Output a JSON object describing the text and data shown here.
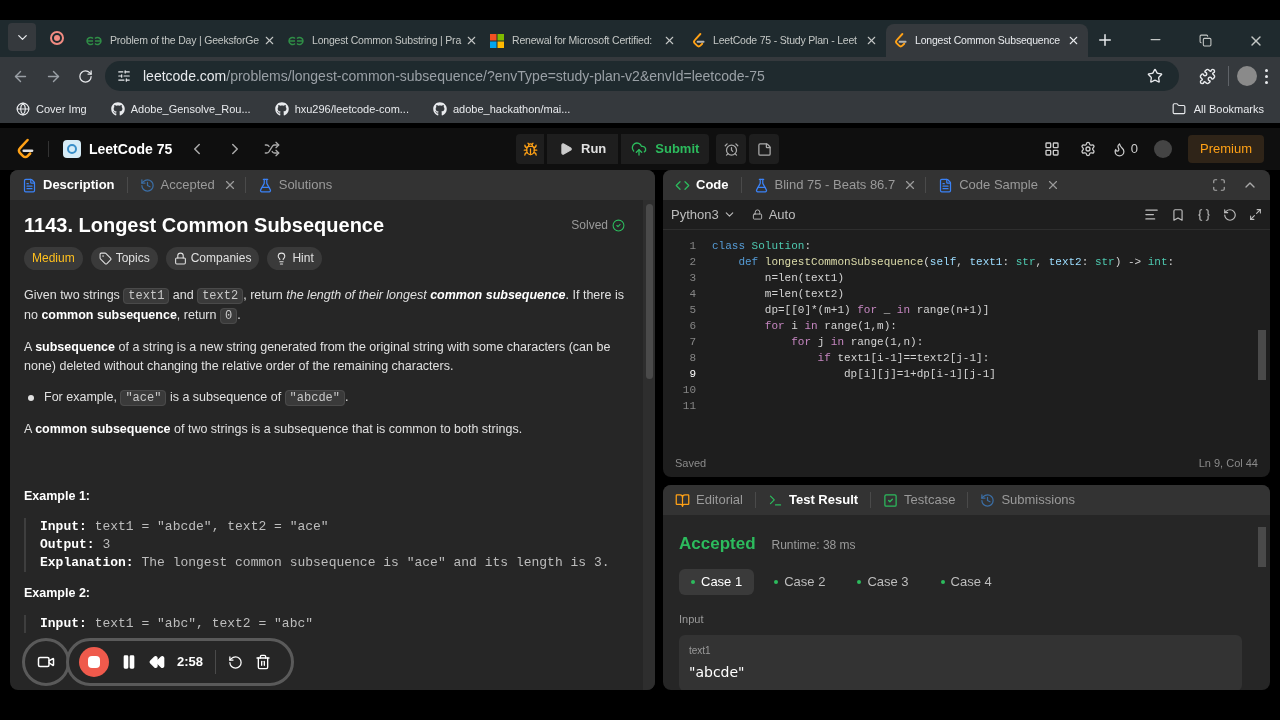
{
  "browser": {
    "tabs": [
      {
        "title": "Problem of the Day | GeeksforGe",
        "selected": false
      },
      {
        "title": "Longest Common Substring | Pra",
        "selected": false
      },
      {
        "title": "Renewal for Microsoft Certified:",
        "selected": false
      },
      {
        "title": "LeetCode 75 - Study Plan - Leet",
        "selected": false
      },
      {
        "title": "Longest Common Subsequence",
        "selected": true
      }
    ],
    "address": {
      "domain": "leetcode.com",
      "path": "/problems/longest-common-subsequence/?envType=study-plan-v2&envId=leetcode-75"
    },
    "bookmarks": [
      "Cover Img",
      "Adobe_Gensolve_Rou...",
      "hxu296/leetcode-com...",
      "adobe_hackathon/mai..."
    ],
    "all_bookmarks": "All Bookmarks"
  },
  "nav": {
    "study_plan": "LeetCode 75",
    "run": "Run",
    "submit": "Submit",
    "streak": "0",
    "premium": "Premium"
  },
  "left_panel": {
    "tabs": [
      {
        "label": "Description",
        "closable": false,
        "selected": true
      },
      {
        "label": "Accepted",
        "closable": true,
        "selected": false
      },
      {
        "label": "Solutions",
        "closable": false,
        "selected": false
      }
    ],
    "title": "1143. Longest Common Subsequence",
    "status": "Solved",
    "chips": [
      {
        "label": "Medium",
        "kind": "difficulty"
      },
      {
        "label": "Topics",
        "kind": "tag"
      },
      {
        "label": "Companies",
        "kind": "lock"
      },
      {
        "label": "Hint",
        "kind": "bulb"
      }
    ],
    "paragraphs": [
      {
        "kind": "text",
        "segments": [
          {
            "t": "Given two strings ",
            "kind": "plain"
          },
          {
            "t": "text1",
            "kind": "code"
          },
          {
            "t": " and ",
            "kind": "plain"
          },
          {
            "t": "text2",
            "kind": "code"
          },
          {
            "t": ", return ",
            "kind": "plain"
          },
          {
            "t": "the length of their longest ",
            "kind": "italic"
          },
          {
            "t": "common subsequence",
            "kind": "bolditalic"
          },
          {
            "t": ". If there is no ",
            "kind": "plain"
          },
          {
            "t": "common subsequence",
            "kind": "bold"
          },
          {
            "t": ", return ",
            "kind": "plain"
          },
          {
            "t": "0",
            "kind": "code"
          },
          {
            "t": ".",
            "kind": "plain"
          }
        ]
      },
      {
        "kind": "text",
        "segments": [
          {
            "t": "A ",
            "kind": "plain"
          },
          {
            "t": "subsequence",
            "kind": "bold"
          },
          {
            "t": " of a string is a new string generated from the original string with some characters (can be none) deleted without changing the relative order of the remaining characters.",
            "kind": "plain"
          }
        ]
      },
      {
        "kind": "bullet",
        "segments": [
          {
            "t": "For example, ",
            "kind": "plain"
          },
          {
            "t": "\"ace\"",
            "kind": "code"
          },
          {
            "t": " is a subsequence of ",
            "kind": "plain"
          },
          {
            "t": "\"abcde\"",
            "kind": "code"
          },
          {
            "t": ".",
            "kind": "plain"
          }
        ]
      },
      {
        "kind": "text",
        "segments": [
          {
            "t": "A ",
            "kind": "plain"
          },
          {
            "t": "common subsequence",
            "kind": "bold"
          },
          {
            "t": " of two strings is a subsequence that is common to both strings.",
            "kind": "plain"
          }
        ]
      }
    ],
    "examples": [
      {
        "title": "Example 1:",
        "lines": [
          {
            "label": "Input:",
            "value": "text1 = \"abcde\", text2 = \"ace\""
          },
          {
            "label": "Output:",
            "value": "3"
          },
          {
            "label": "Explanation:",
            "value": "The longest common subsequence is \"ace\" and its length is 3."
          }
        ]
      },
      {
        "title": "Example 2:",
        "lines": [
          {
            "label": "Input:",
            "value": "text1 = \"abc\", text2 = \"abc\""
          }
        ]
      }
    ]
  },
  "editor": {
    "tabs": [
      {
        "label": "Code",
        "closable": false,
        "selected": true
      },
      {
        "label": "Blind 75 - Beats 86.7",
        "closable": true,
        "selected": false
      },
      {
        "label": "Code Sample",
        "closable": true,
        "selected": false
      }
    ],
    "language": "Python3",
    "mode": "Auto",
    "lines": [
      {
        "n": "1",
        "current": false,
        "tokens": [
          {
            "t": "class",
            "kind": "kw"
          },
          {
            "t": " Solution",
            "kind": "cls"
          },
          {
            "t": ":",
            "kind": "plain"
          }
        ]
      },
      {
        "n": "2",
        "current": false,
        "tokens": [
          {
            "t": "    def",
            "kind": "kw"
          },
          {
            "t": " longestCommonSubsequence",
            "kind": "fn"
          },
          {
            "t": "(",
            "kind": "plain"
          },
          {
            "t": "self",
            "kind": "param"
          },
          {
            "t": ", ",
            "kind": "plain"
          },
          {
            "t": "text1",
            "kind": "param"
          },
          {
            "t": ": ",
            "kind": "plain"
          },
          {
            "t": "str",
            "kind": "type"
          },
          {
            "t": ", ",
            "kind": "plain"
          },
          {
            "t": "text2",
            "kind": "param"
          },
          {
            "t": ": ",
            "kind": "plain"
          },
          {
            "t": "str",
            "kind": "type"
          },
          {
            "t": ") -> ",
            "kind": "plain"
          },
          {
            "t": "int",
            "kind": "type"
          },
          {
            "t": ":",
            "kind": "plain"
          }
        ]
      },
      {
        "n": "3",
        "current": false,
        "tokens": [
          {
            "t": "        n=len(text1)",
            "kind": "plain"
          }
        ]
      },
      {
        "n": "4",
        "current": false,
        "tokens": [
          {
            "t": "        m=len(text2)",
            "kind": "plain"
          }
        ]
      },
      {
        "n": "5",
        "current": false,
        "tokens": [
          {
            "t": "        dp=[[0]*(m+1) ",
            "kind": "plain"
          },
          {
            "t": "for",
            "kind": "ctrl"
          },
          {
            "t": " _ ",
            "kind": "plain"
          },
          {
            "t": "in",
            "kind": "ctrl"
          },
          {
            "t": " range(n+1)]",
            "kind": "plain"
          }
        ]
      },
      {
        "n": "6",
        "current": false,
        "tokens": [
          {
            "t": "        for",
            "kind": "ctrl"
          },
          {
            "t": " i ",
            "kind": "plain"
          },
          {
            "t": "in",
            "kind": "ctrl"
          },
          {
            "t": " range(1,m):",
            "kind": "plain"
          }
        ]
      },
      {
        "n": "7",
        "current": false,
        "tokens": [
          {
            "t": "            for",
            "kind": "ctrl"
          },
          {
            "t": " j ",
            "kind": "plain"
          },
          {
            "t": "in",
            "kind": "ctrl"
          },
          {
            "t": " range(1,n):",
            "kind": "plain"
          }
        ]
      },
      {
        "n": "8",
        "current": false,
        "tokens": [
          {
            "t": "                if",
            "kind": "ctrl"
          },
          {
            "t": " text1[i-1]==text2[j-1]:",
            "kind": "plain"
          }
        ]
      },
      {
        "n": "9",
        "current": true,
        "tokens": [
          {
            "t": "                    dp[i][j]=1+dp[i-1][j-1]",
            "kind": "plain"
          }
        ]
      },
      {
        "n": "10",
        "current": false
      },
      {
        "n": "11",
        "current": false
      }
    ],
    "saved": "Saved",
    "cursor": "Ln 9, Col 44"
  },
  "result_panel": {
    "tabs": [
      {
        "label": "Editorial",
        "selected": false
      },
      {
        "label": "Test Result",
        "selected": true
      },
      {
        "label": "Testcase",
        "selected": false
      },
      {
        "label": "Submissions",
        "selected": false
      }
    ],
    "verdict": "Accepted",
    "runtime": "Runtime: 38 ms",
    "cases": [
      {
        "label": "Case 1",
        "selected": true
      },
      {
        "label": "Case 2",
        "selected": false
      },
      {
        "label": "Case 3",
        "selected": false
      },
      {
        "label": "Case 4",
        "selected": false
      }
    ],
    "input_label": "Input",
    "param": "text1",
    "value": "\"abcde\""
  },
  "recorder": {
    "time": "2:58"
  }
}
